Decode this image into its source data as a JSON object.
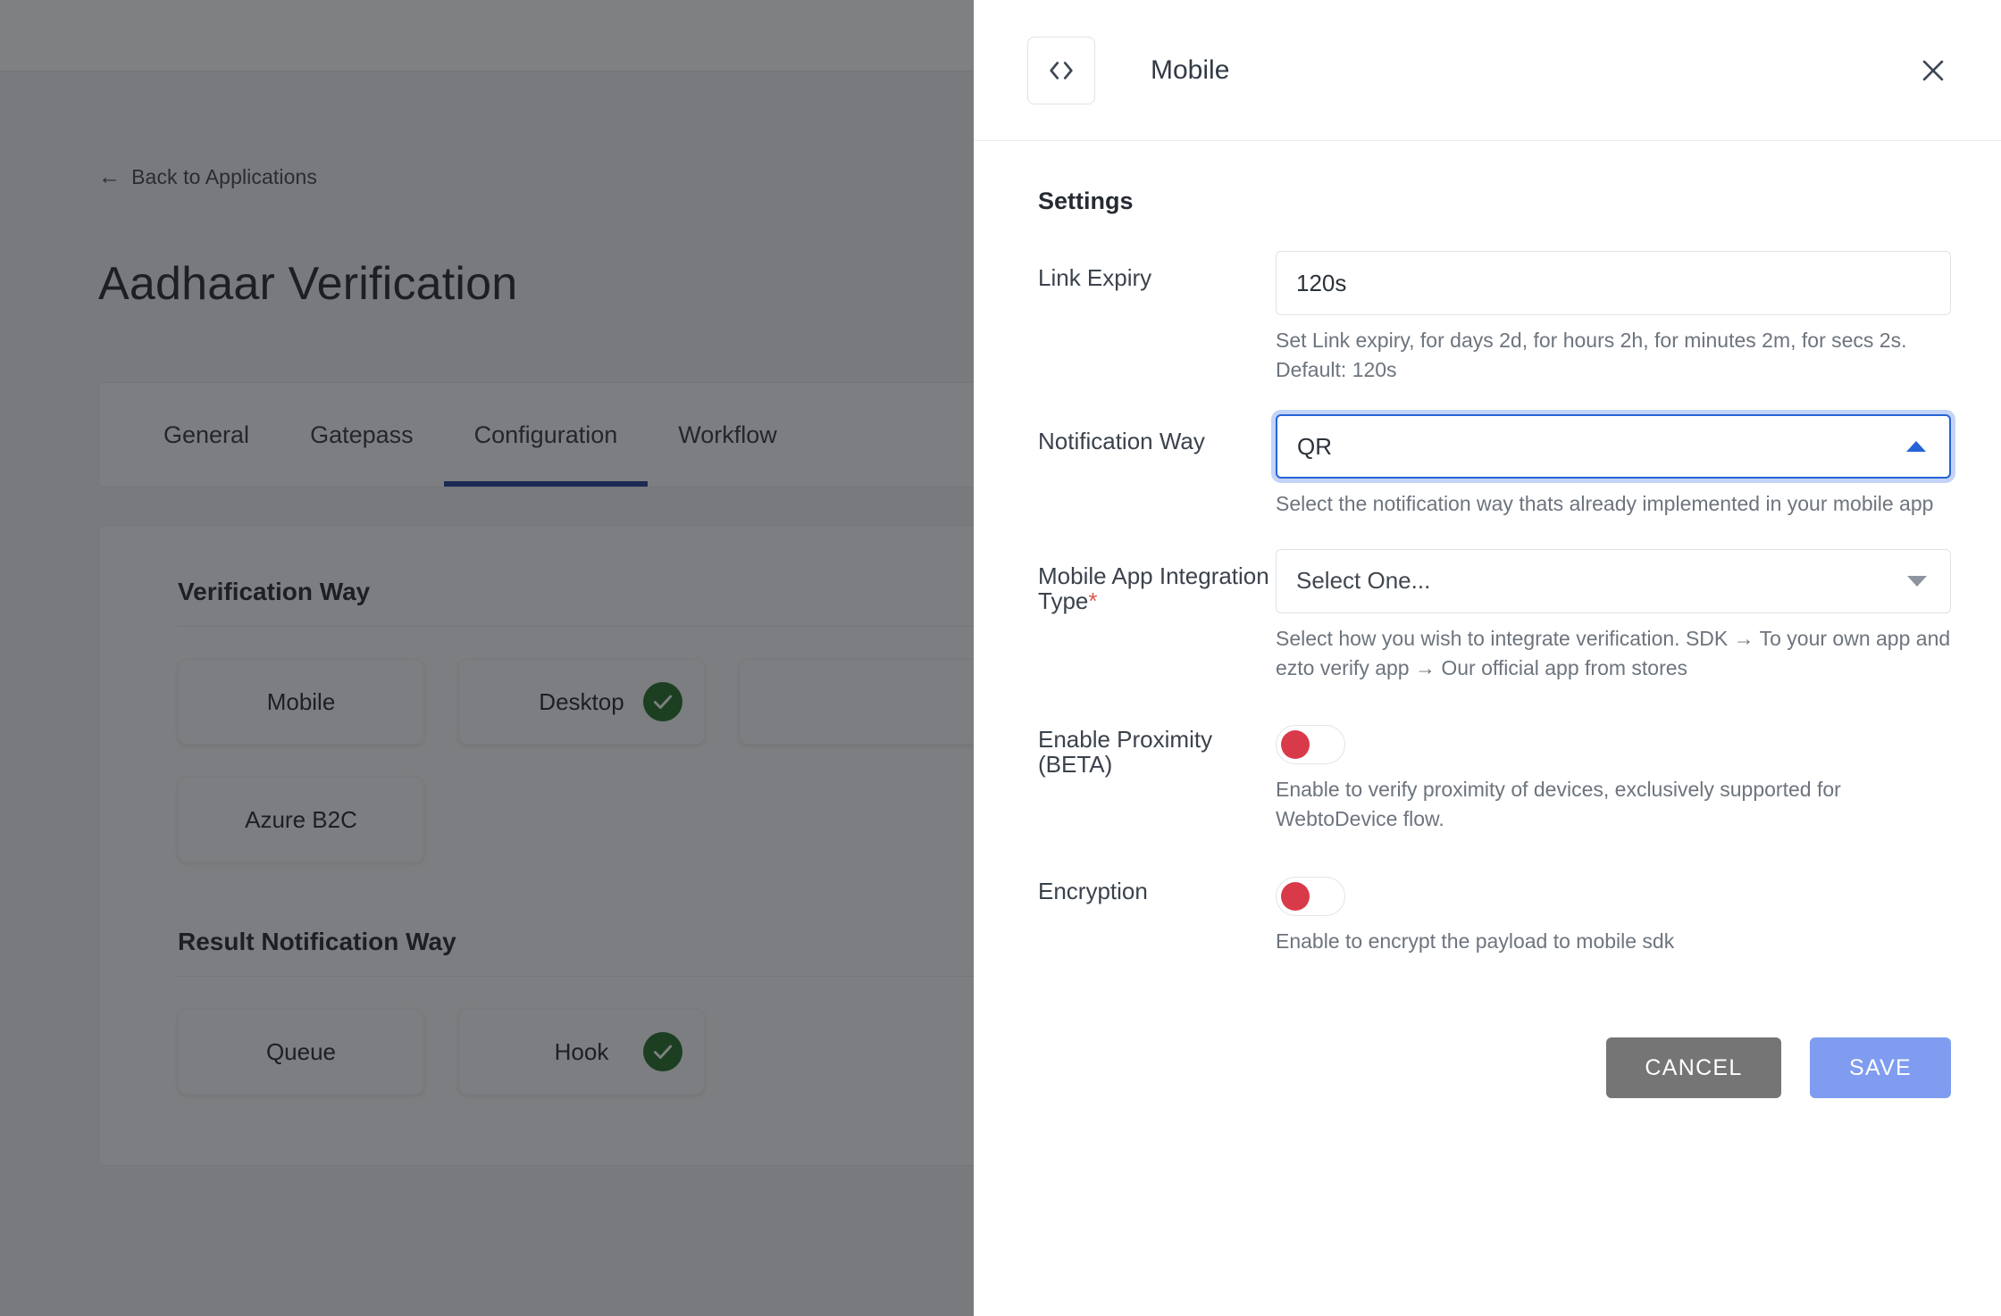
{
  "background": {
    "back_link": "Back to Applications",
    "back_arrow_icon": "arrow-left-icon",
    "page_title": "Aadhaar Verification",
    "tabs": [
      {
        "label": "General",
        "active": false
      },
      {
        "label": "Gatepass",
        "active": false
      },
      {
        "label": "Configuration",
        "active": true
      },
      {
        "label": "Workflow",
        "active": false
      }
    ],
    "sections": [
      {
        "title": "Verification Way",
        "cards": [
          {
            "label": "Mobile",
            "selected": false
          },
          {
            "label": "Desktop",
            "selected": true
          },
          {
            "label": "",
            "selected": false
          },
          {
            "label": "Azure B2C",
            "selected": false
          }
        ]
      },
      {
        "title": "Result Notification Way",
        "cards": [
          {
            "label": "Queue",
            "selected": false
          },
          {
            "label": "Hook",
            "selected": true
          }
        ]
      }
    ]
  },
  "drawer": {
    "app_icon": "code-brackets-icon",
    "title": "Mobile",
    "close_icon": "close-icon",
    "settings_heading": "Settings",
    "fields": {
      "link_expiry": {
        "label": "Link Expiry",
        "value": "120s",
        "placeholder": "",
        "help": "Set Link expiry, for days 2d, for hours 2h, for minutes 2m, for secs 2s. Default: 120s"
      },
      "notification_way": {
        "label": "Notification Way",
        "value": "QR",
        "help": "Select the notification way thats already implemented in your mobile app",
        "expanded": true,
        "caret_icon": "chevron-up-icon"
      },
      "integration_type": {
        "label": "Mobile App Integration Type",
        "required_marker": "*",
        "value": "Select One...",
        "help": "Select how you wish to integrate verification. SDK → To your own app and ezto verify app → Our official app from stores",
        "caret_icon": "chevron-down-icon"
      },
      "proximity": {
        "label": "Enable Proximity (BETA)",
        "state": "off",
        "help": "Enable to verify proximity of devices, exclusively supported for WebtoDevice flow."
      },
      "encryption": {
        "label": "Encryption",
        "state": "off",
        "help": "Enable to encrypt the payload to mobile sdk"
      }
    },
    "actions": {
      "cancel_label": "CANCEL",
      "save_label": "SAVE"
    }
  },
  "colors": {
    "tab_accent": "#1f3a93",
    "focus_blue": "#2563d6",
    "ok_green": "#1f6b22",
    "toggle_off": "#d93a4a",
    "btn_cancel": "#757575",
    "btn_save": "#7f9cf0"
  }
}
